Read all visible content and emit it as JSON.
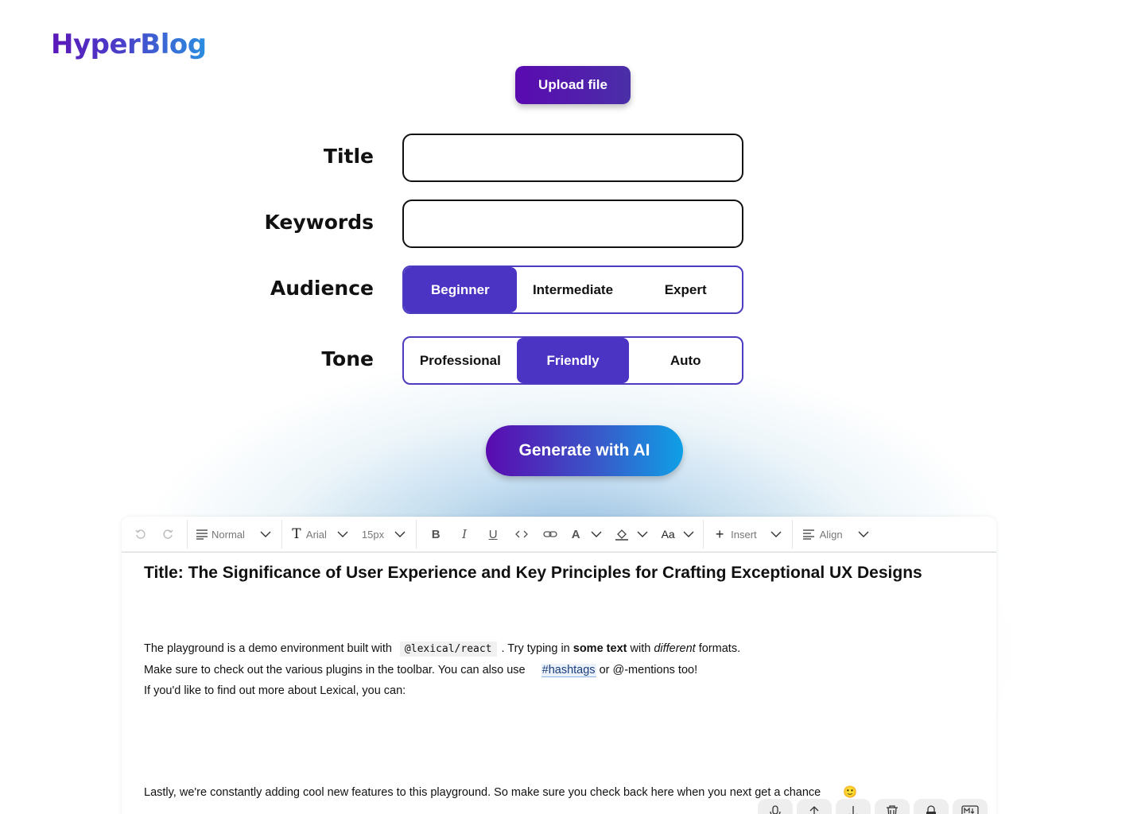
{
  "app": {
    "logo": "HyperBlog"
  },
  "upload": {
    "label": "Upload file"
  },
  "form": {
    "title": {
      "label": "Title",
      "value": "",
      "placeholder": ""
    },
    "keywords": {
      "label": "Keywords",
      "value": "",
      "placeholder": ""
    },
    "audience": {
      "label": "Audience",
      "options": [
        "Beginner",
        "Intermediate",
        "Expert"
      ],
      "selected": "Beginner"
    },
    "tone": {
      "label": "Tone",
      "options": [
        "Professional",
        "Friendly",
        "Auto"
      ],
      "selected": "Friendly"
    }
  },
  "generate": {
    "label": "Generate with AI"
  },
  "toolbar": {
    "block_type": "Normal",
    "font_family": "Arial",
    "font_size": "15px",
    "case_label": "Aa",
    "insert_label": "Insert",
    "align_label": "Align",
    "icons": [
      "undo-icon",
      "redo-icon",
      "paragraph-icon",
      "font-icon",
      "bold-icon",
      "italic-icon",
      "underline-icon",
      "code-icon",
      "link-icon",
      "font-color-icon",
      "bg-color-icon",
      "plus-icon",
      "align-icon",
      "chevron-down-icon"
    ]
  },
  "editor": {
    "title": "Title: The Significance of User Experience and Key Principles for Crafting Exceptional UX Designs",
    "line1": {
      "a": "The playground is a demo environment built with",
      "code": "@lexical/react",
      "b": ". Try typing in ",
      "bold": "some text",
      "c": " with ",
      "italic": "different",
      "d": " formats."
    },
    "line2": {
      "a": "Make sure to check out the various plugins in the toolbar. You can also use",
      "hashtag": "#hashtags",
      "b": " or @-mentions too!"
    },
    "line3": "If you'd like to find out more about Lexical, you can:",
    "line4": "Lastly, we're constantly adding cool new features to this playground. So make sure you check back here when you next get a chance",
    "emoji": "🙂"
  },
  "actions": {
    "icons": [
      "microphone-icon",
      "import-icon",
      "export-icon",
      "trash-icon",
      "lock-icon",
      "markdown-icon"
    ]
  },
  "colors": {
    "accent": "#4b33c4",
    "gradient_start": "#5a0ab0",
    "gradient_end": "#0fa0e6"
  }
}
